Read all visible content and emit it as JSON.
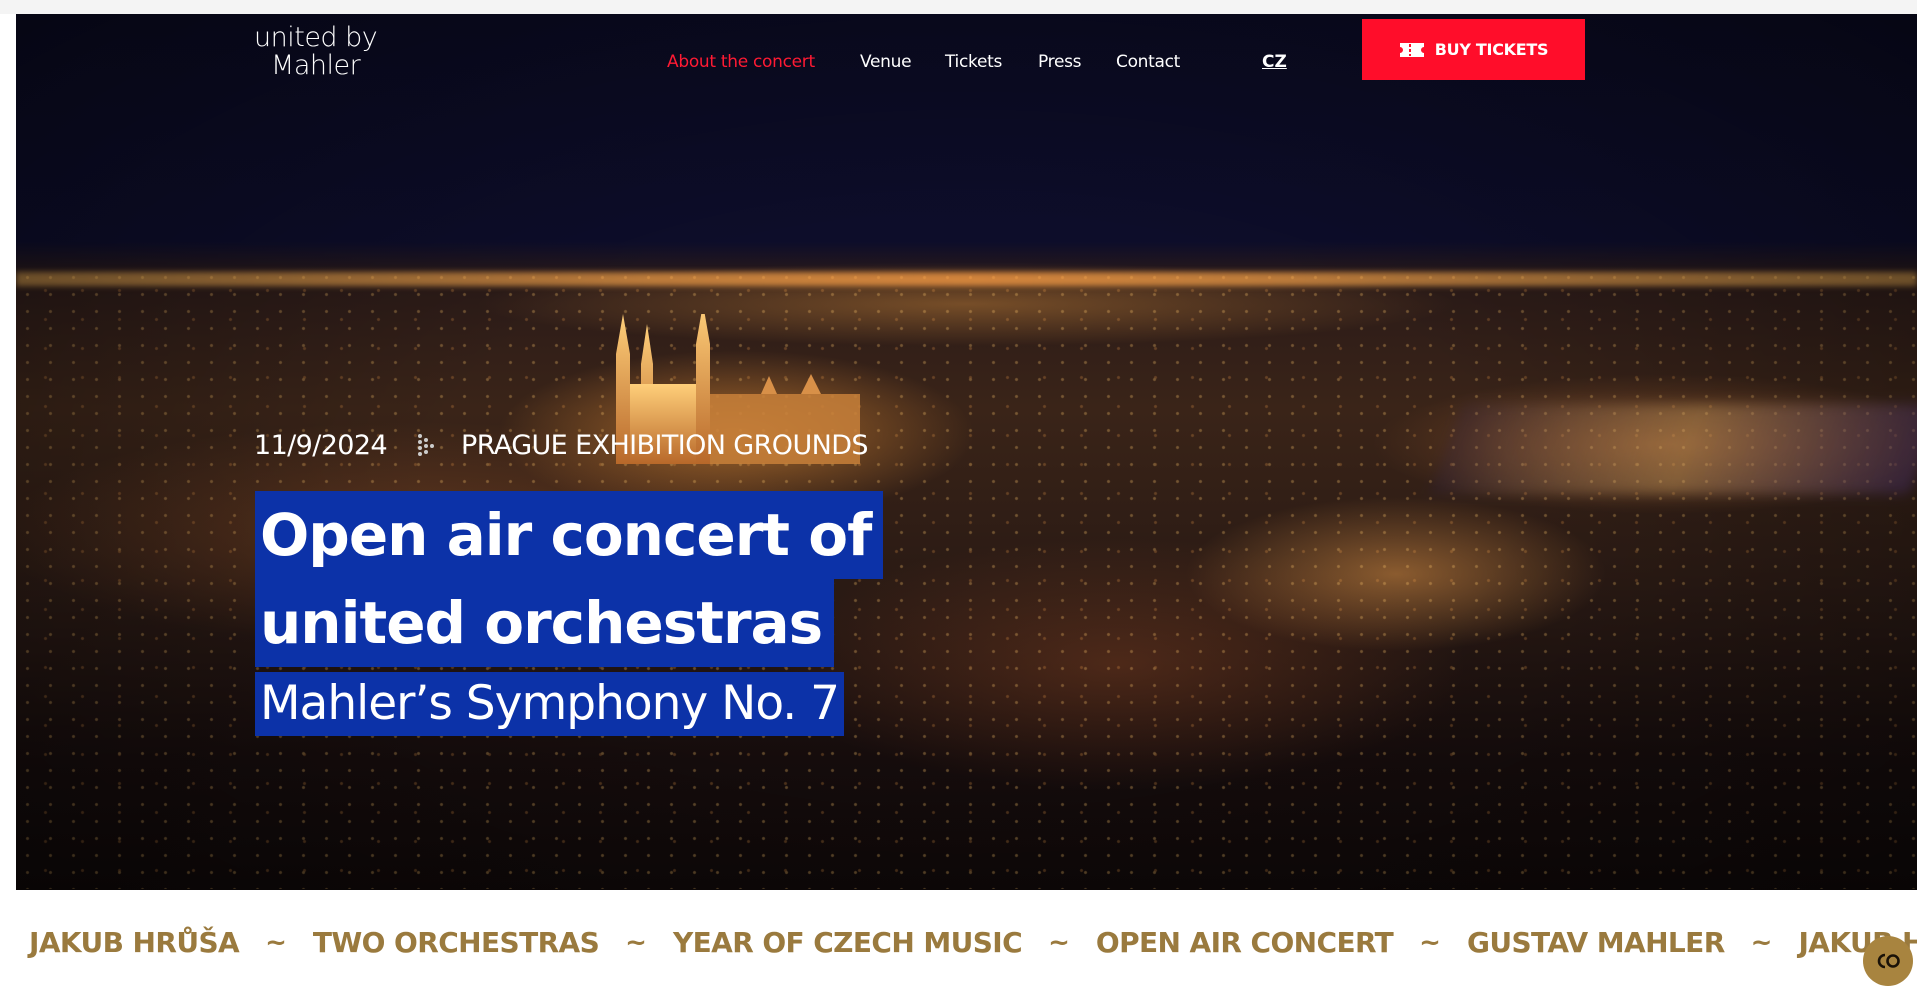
{
  "logo": {
    "line1": "united by",
    "line2": "Mahler"
  },
  "nav": {
    "items": [
      {
        "label": "About the concert",
        "active": true
      },
      {
        "label": "Venue",
        "active": false
      },
      {
        "label": "Tickets",
        "active": false
      },
      {
        "label": "Press",
        "active": false
      },
      {
        "label": "Contact",
        "active": false
      }
    ],
    "language": "CZ",
    "buy_label": "BUY TICKETS"
  },
  "hero": {
    "date": "11/9/2024",
    "location": "PRAGUE EXHIBITION GROUNDS",
    "headline_line1": "Open air concert of",
    "headline_line2": "united orchestras",
    "subtitle": "Mahler’s Symphony No. 7"
  },
  "ticker": {
    "items": [
      "JAKUB HRŮŠA",
      "TWO ORCHESTRAS",
      "YEAR OF CZECH MUSIC",
      "OPEN AIR CONCERT",
      "GUSTAV MAHLER",
      "JAKUB HRŮŠA"
    ],
    "separator": "~"
  },
  "colors": {
    "accent_red": "#ff0d2a",
    "headline_bg": "#0c32a8",
    "ticker_gold": "#9a7a3e",
    "cookie_button": "#a8843f"
  },
  "icons": {
    "ticket": "ticket-icon",
    "separator": "play-dots-icon",
    "cookie": "cookie-settings-icon"
  }
}
